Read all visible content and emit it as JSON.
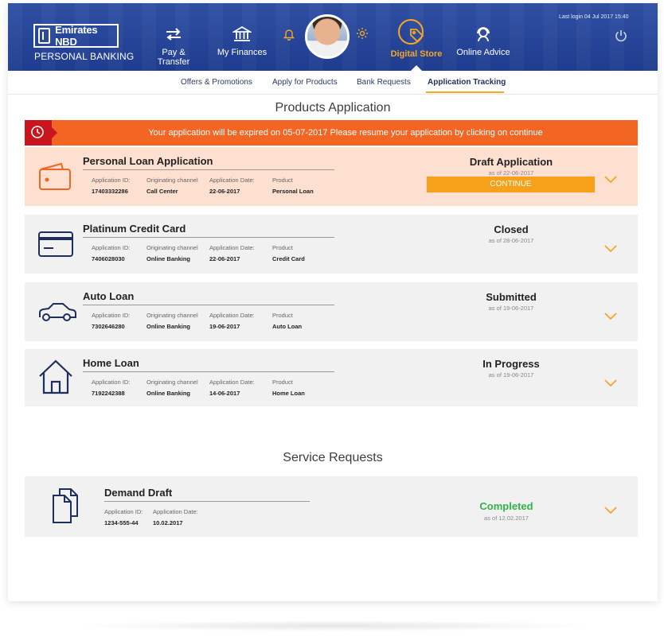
{
  "header": {
    "brand": "Emirates NBD",
    "subtitle": "PERSONAL BANKING",
    "last_login": "Last login 04 Jul 2017 15:40",
    "nav": [
      {
        "label": "Pay & Transfer",
        "icon": "transfer-arrows-icon"
      },
      {
        "label": "My Finances",
        "icon": "bank-building-icon"
      },
      {
        "label": "Digital Store",
        "icon": "tag-icon",
        "active": true
      },
      {
        "label": "Online Advice",
        "icon": "headset-icon"
      }
    ]
  },
  "subnav": {
    "items": [
      "Offers & Promotions",
      "Apply for Products",
      "Bank Requests",
      "Application Tracking"
    ],
    "active": "Application Tracking"
  },
  "products": {
    "title": "Products Application",
    "banner": "Your application will be expired on 05-07-2017 Please resume your application by clicking on continue",
    "labels": {
      "id": "Application ID:",
      "channel": "Originating channel",
      "date": "Application Date:",
      "product": "Product"
    },
    "items": [
      {
        "title": "Personal Loan Application",
        "id": "17403332286",
        "channel": "Call Center",
        "date": "22-06-2017",
        "product": "Personal Loan",
        "status": "Draft Application",
        "as_of": "as of 22-06-2017",
        "button": "CONTINUE",
        "icon": "wallet-icon"
      },
      {
        "title": "Platinum Credit Card",
        "id": "7406028030",
        "channel": "Online Banking",
        "date": "22-06-2017",
        "product": "Credit Card",
        "status": "Closed",
        "as_of": "as of 28-06-2017",
        "icon": "credit-card-icon"
      },
      {
        "title": "Auto Loan",
        "id": "7302646280",
        "channel": "Online Banking",
        "date": "19-06-2017",
        "product": "Auto Loan",
        "status": "Submitted",
        "as_of": "as of 19-06-2017",
        "icon": "car-icon"
      },
      {
        "title": "Home Loan",
        "id": "7192242388",
        "channel": "Online Banking",
        "date": "14-06-2017",
        "product": "Home Loan",
        "status": "In Progress",
        "as_of": "as of 19-06-2017",
        "icon": "house-icon"
      }
    ]
  },
  "services": {
    "title": "Service Requests",
    "labels": {
      "id": "Application ID:",
      "date": "Application Date:"
    },
    "items": [
      {
        "title": "Demand Draft",
        "id": "1234-555-44",
        "date": "10.02.2017",
        "status": "Completed",
        "as_of": "as of 12.02.2017",
        "icon": "documents-icon"
      }
    ]
  },
  "colors": {
    "header_blue": "#1f3c8f",
    "accent_orange": "#f5a623",
    "banner_orange": "#f26522",
    "banner_red": "#c9151d",
    "status_green": "#2fb44a",
    "icon_navy": "#1f2f5d"
  }
}
